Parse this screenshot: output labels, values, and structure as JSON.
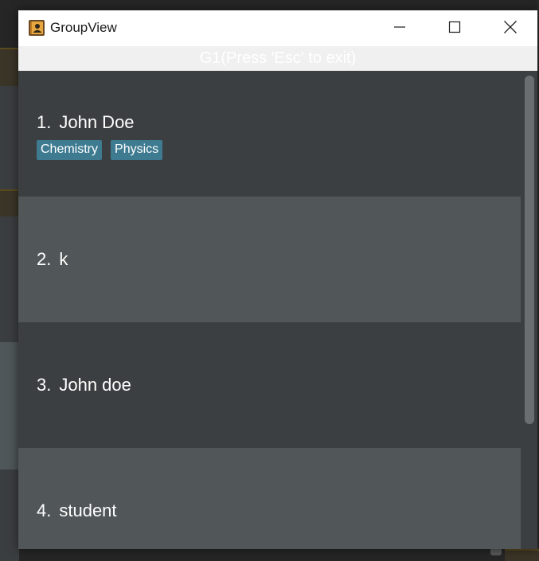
{
  "window": {
    "title": "GroupView",
    "header": "G1(Press 'Esc' to exit)"
  },
  "icons": {
    "app": "contact-book-icon",
    "minimize": "minimize-icon",
    "maximize": "maximize-icon",
    "close": "close-icon"
  },
  "colors": {
    "card_dark": "#3c3f41",
    "card_light": "#515658",
    "tag": "#3e7b91",
    "titlebar": "#ffffff",
    "header_strip": "#f0f0f0"
  },
  "persons": [
    {
      "index": "1.",
      "name": "John Doe",
      "tags": [
        "Chemistry",
        "Physics"
      ]
    },
    {
      "index": "2.",
      "name": "k",
      "tags": []
    },
    {
      "index": "3.",
      "name": "John doe",
      "tags": []
    },
    {
      "index": "4.",
      "name": "student",
      "tags": []
    }
  ]
}
